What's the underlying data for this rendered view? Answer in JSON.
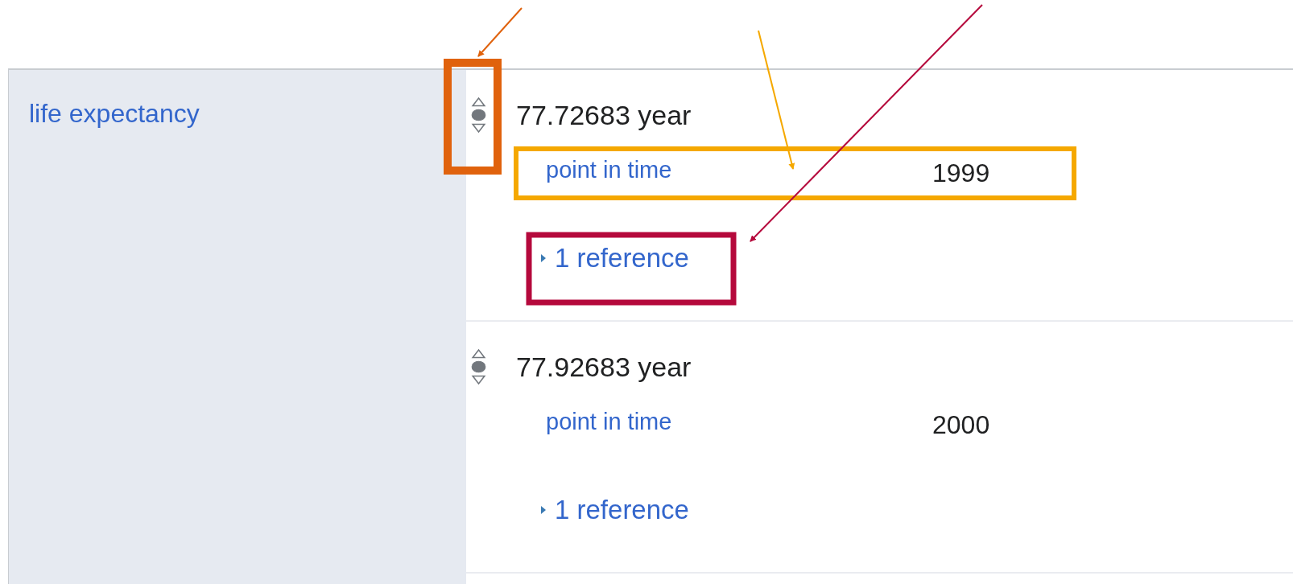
{
  "property": {
    "label": "life expectancy"
  },
  "statements": [
    {
      "preferred": false,
      "deprecated": false,
      "value": "77.72683 year",
      "qualifiers": [
        {
          "property": "point in time",
          "value": "1999"
        }
      ],
      "references": {
        "label": "1 reference",
        "expanded": false
      }
    },
    {
      "preferred": false,
      "deprecated": false,
      "value": "77.92683 year",
      "qualifiers": [
        {
          "property": "point in time",
          "value": "2000"
        }
      ],
      "references": {
        "label": "1 reference",
        "expanded": false
      }
    }
  ],
  "annotations": [
    {
      "color": "#e0620d"
    },
    {
      "color": "#f5a800"
    },
    {
      "color": "#b5093c"
    }
  ]
}
